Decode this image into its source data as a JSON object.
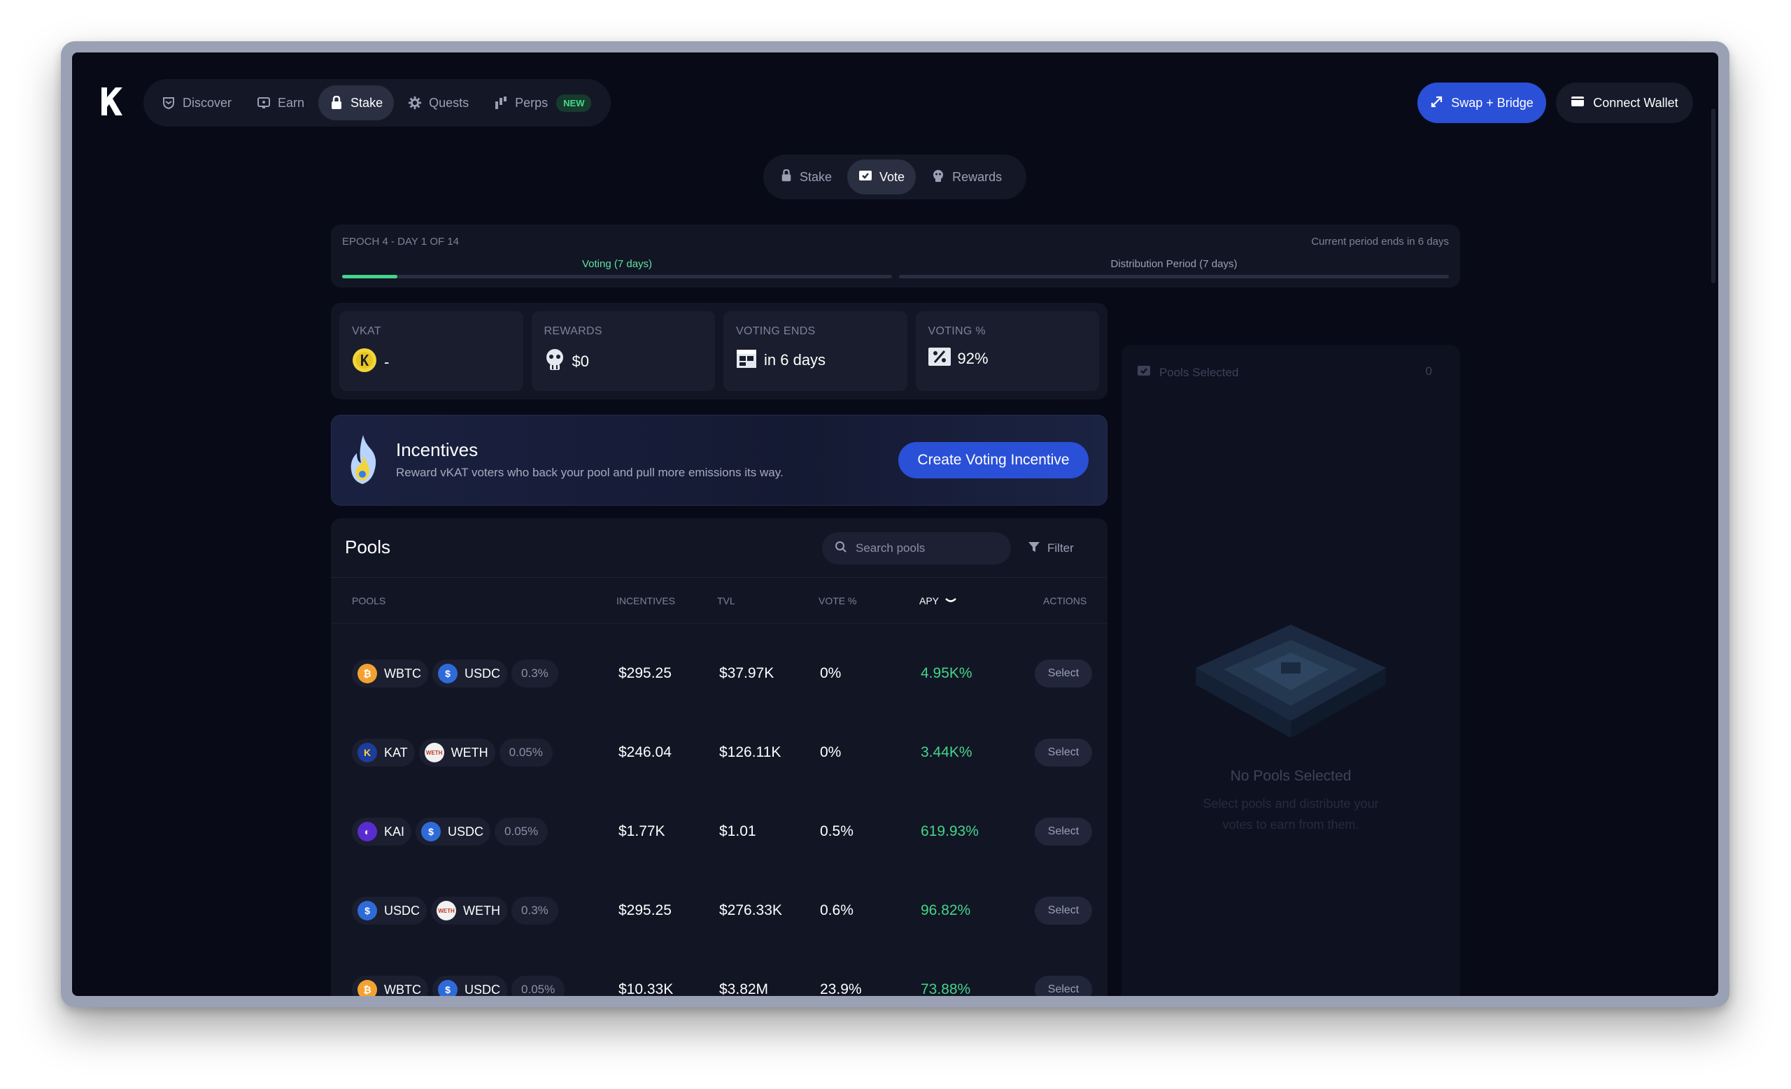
{
  "nav": {
    "items": [
      {
        "label": "Discover",
        "icon": "shield-icon",
        "active": false
      },
      {
        "label": "Earn",
        "icon": "earn-icon",
        "active": false
      },
      {
        "label": "Stake",
        "icon": "lock-icon",
        "active": true
      },
      {
        "label": "Quests",
        "icon": "gear-icon",
        "active": false
      },
      {
        "label": "Perps",
        "icon": "bars-icon",
        "active": false
      }
    ],
    "new_badge": "NEW",
    "swap_label": "Swap + Bridge",
    "wallet_label": "Connect Wallet"
  },
  "subtabs": [
    {
      "label": "Stake",
      "active": false
    },
    {
      "label": "Vote",
      "active": true
    },
    {
      "label": "Rewards",
      "active": false
    }
  ],
  "epoch": {
    "label": "EPOCH 4 - DAY 1 OF 14",
    "period_end": "Current period ends in 6 days",
    "phase1": "Voting (7 days)",
    "phase2": "Distribution Period (7 days)",
    "phase1_progress": 0.1
  },
  "stats": [
    {
      "title": "vKAT",
      "value": "-"
    },
    {
      "title": "REWARDS",
      "value": "$0"
    },
    {
      "title": "VOTING ENDS",
      "value": "in 6 days"
    },
    {
      "title": "VOTING %",
      "value": "92%"
    }
  ],
  "incentives": {
    "title": "Incentives",
    "subtitle": "Reward vKAT voters who back your pool and pull more emissions its way.",
    "cta": "Create Voting Incentive"
  },
  "pools": {
    "title": "Pools",
    "search_placeholder": "Search pools",
    "filter_label": "Filter",
    "columns": [
      "POOLS",
      "INCENTIVES",
      "TVL",
      "VOTE %",
      "APY",
      "ACTIONS"
    ],
    "rows": [
      {
        "token_a": "WBTC",
        "token_b": "USDC",
        "fee": "0.3%",
        "incentives": "$295.25",
        "tvl": "$37.97K",
        "vote": "0%",
        "apy": "4.95K%",
        "action": "Select"
      },
      {
        "token_a": "KAT",
        "token_b": "WETH",
        "fee": "0.05%",
        "incentives": "$246.04",
        "tvl": "$126.11K",
        "vote": "0%",
        "apy": "3.44K%",
        "action": "Select"
      },
      {
        "token_a": "KAI",
        "token_b": "USDC",
        "fee": "0.05%",
        "incentives": "$1.77K",
        "tvl": "$1.01",
        "vote": "0.5%",
        "apy": "619.93%",
        "action": "Select"
      },
      {
        "token_a": "USDC",
        "token_b": "WETH",
        "fee": "0.3%",
        "incentives": "$295.25",
        "tvl": "$276.33K",
        "vote": "0.6%",
        "apy": "96.82%",
        "action": "Select"
      },
      {
        "token_a": "WBTC",
        "token_b": "USDC",
        "fee": "0.05%",
        "incentives": "$10.33K",
        "tvl": "$3.82M",
        "vote": "23.9%",
        "apy": "73.88%",
        "action": "Select"
      }
    ]
  },
  "side": {
    "header": "Pools Selected",
    "count": "0",
    "empty_title": "No Pools Selected",
    "empty_desc": "Select pools and distribute your votes to earn from them."
  },
  "colors": {
    "accent": "#2a50d8",
    "positive": "#43d58b",
    "background": "#080a17"
  }
}
